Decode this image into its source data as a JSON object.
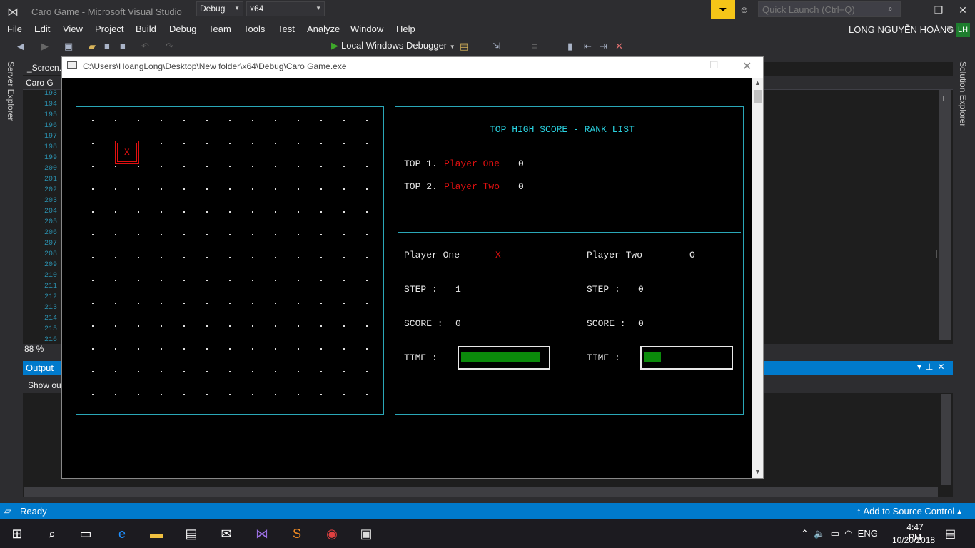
{
  "vs": {
    "title": "Caro Game - Microsoft Visual Studio",
    "quick_launch_placeholder": "Quick Launch (Ctrl+Q)",
    "menu": [
      "File",
      "Edit",
      "View",
      "Project",
      "Build",
      "Debug",
      "Team",
      "Tools",
      "Test",
      "Analyze",
      "Window",
      "Help"
    ],
    "user_name": "LONG NGUYỄN HOÀNG",
    "avatar_initials": "LH",
    "config": "Debug",
    "platform": "x64",
    "debugger": "Local Windows Debugger",
    "server_explorer": "Server Explorer",
    "solution_explorer": "Solution Explorer",
    "doc_tab": "_Screen.c",
    "nav_file": "Caro G",
    "line_numbers": "193\n194\n195\n196\n197\n198\n199\n200\n201\n202\n203\n204\n205\n206\n207\n208\n209\n210\n211\n212\n213\n214\n215\n216",
    "zoom": "88 %",
    "output_title": "Output",
    "show_output": "Show ou",
    "status": "Ready",
    "source_control": "Add to Source Control"
  },
  "console": {
    "title": "C:\\Users\\HoangLong\\Desktop\\New folder\\x64\\Debug\\Caro Game.exe",
    "board": {
      "cols": 13,
      "rows": 13,
      "marks": [
        {
          "row": 1,
          "col": 1,
          "symbol": "X"
        }
      ]
    },
    "rank_title": "TOP HIGH SCORE - RANK LIST",
    "rank_list": [
      {
        "label": "TOP 1.",
        "name": "Player One",
        "score": "0"
      },
      {
        "label": "TOP 2.",
        "name": "Player Two",
        "score": "0"
      }
    ],
    "player_one": {
      "name": "Player One",
      "symbol": "X",
      "step_label": "STEP :",
      "step": "1",
      "score_label": "SCORE :",
      "score": "0",
      "time_label": "TIME :",
      "time_fraction": 0.92
    },
    "player_two": {
      "name": "Player Two",
      "symbol": "O",
      "step_label": "STEP :",
      "step": "0",
      "score_label": "SCORE :",
      "score": "0",
      "time_label": "TIME :",
      "time_fraction": 0.2
    }
  },
  "taskbar": {
    "time": "4:47 PM",
    "date": "10/20/2018",
    "language": "ENG"
  },
  "colors": {
    "accent": "#007acc",
    "board_border": "#2aa7b8",
    "mark": "#e01010",
    "timer": "#0b8a0b"
  }
}
